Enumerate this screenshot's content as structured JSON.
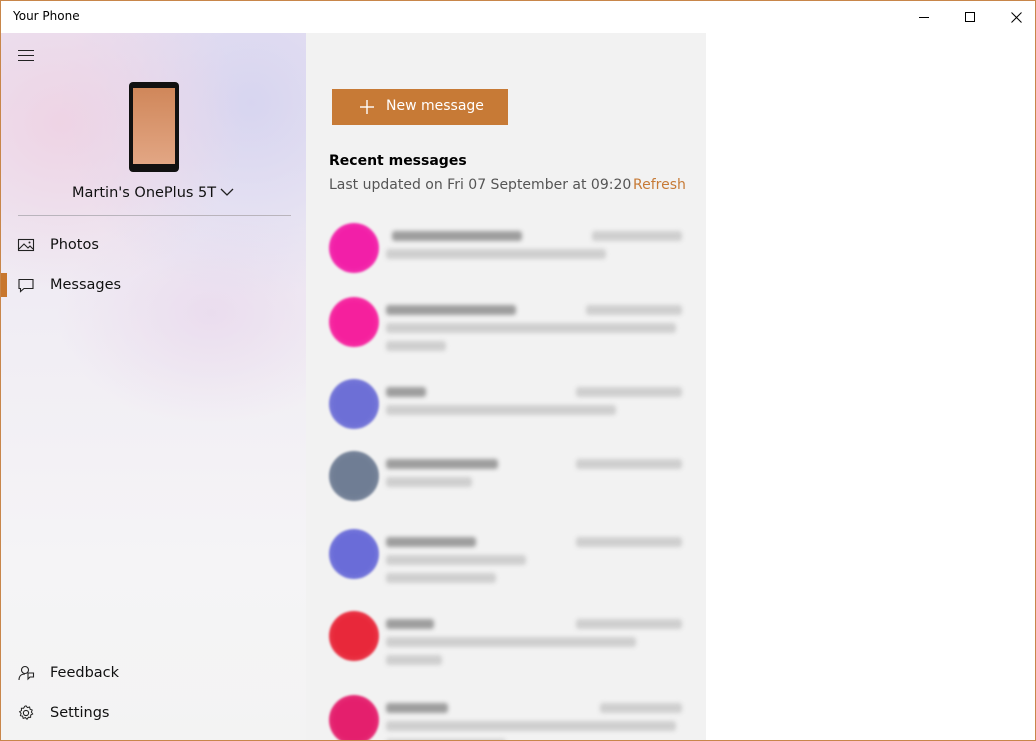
{
  "window": {
    "title": "Your Phone"
  },
  "sidebar": {
    "device_name": "Martin's OnePlus 5T",
    "nav": [
      {
        "label": "Photos",
        "icon": "photos-icon",
        "active": false
      },
      {
        "label": "Messages",
        "icon": "messages-icon",
        "active": true
      }
    ],
    "footer": [
      {
        "label": "Feedback",
        "icon": "feedback-icon"
      },
      {
        "label": "Settings",
        "icon": "gear-icon"
      }
    ]
  },
  "main": {
    "new_message_label": "New message",
    "recent_title": "Recent messages",
    "last_updated": "Last updated on Fri 07 September at 09:20",
    "refresh_label": "Refresh",
    "conversations": [
      {
        "avatar_color": "#f21fa8"
      },
      {
        "avatar_color": "#f5209d"
      },
      {
        "avatar_color": "#6d6fd6"
      },
      {
        "avatar_color": "#6f7d94"
      },
      {
        "avatar_color": "#6a6cd8"
      },
      {
        "avatar_color": "#e8283a"
      },
      {
        "avatar_color": "#e41f6d"
      }
    ]
  },
  "colors": {
    "accent": "#c77a36",
    "active_indicator": "#c8772e"
  }
}
